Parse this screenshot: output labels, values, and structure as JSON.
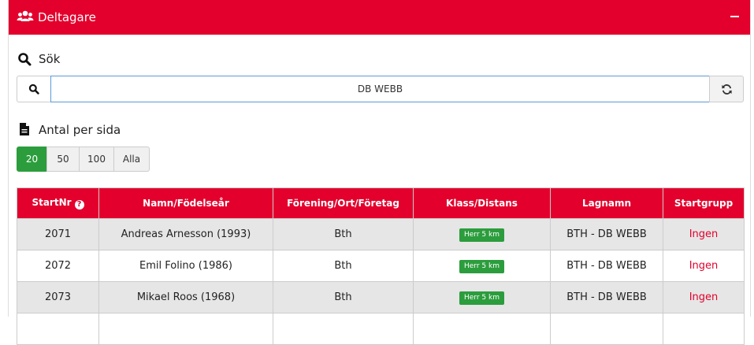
{
  "panel": {
    "title": "Deltagare",
    "icon": "users-icon",
    "accent": "#e3002c"
  },
  "search": {
    "label": "Sök",
    "value": "DB WEBB",
    "refresh_icon": "refresh-icon"
  },
  "page_size": {
    "label": "Antal per sida",
    "options": [
      "20",
      "50",
      "100",
      "Alla"
    ],
    "selected": "20",
    "active_color": "#2c9d3d"
  },
  "table": {
    "headers": {
      "startnr": "StartNr",
      "name": "Namn/Födelseår",
      "club": "Förening/Ort/Företag",
      "class": "Klass/Distans",
      "team": "Lagnamn",
      "group": "Startgrupp"
    },
    "rows": [
      {
        "startnr": "2071",
        "name": "Andreas Arnesson (1993)",
        "club": "Bth",
        "class": "Herr 5 km",
        "team": "BTH - DB WEBB",
        "group": "Ingen"
      },
      {
        "startnr": "2072",
        "name": "Emil Folino (1986)",
        "club": "Bth",
        "class": "Herr 5 km",
        "team": "BTH - DB WEBB",
        "group": "Ingen"
      },
      {
        "startnr": "2073",
        "name": "Mikael Roos (1968)",
        "club": "Bth",
        "class": "Herr 5 km",
        "team": "BTH - DB WEBB",
        "group": "Ingen"
      },
      {
        "startnr": "",
        "name": "",
        "club": "",
        "class": "",
        "team": "",
        "group": ""
      }
    ]
  }
}
